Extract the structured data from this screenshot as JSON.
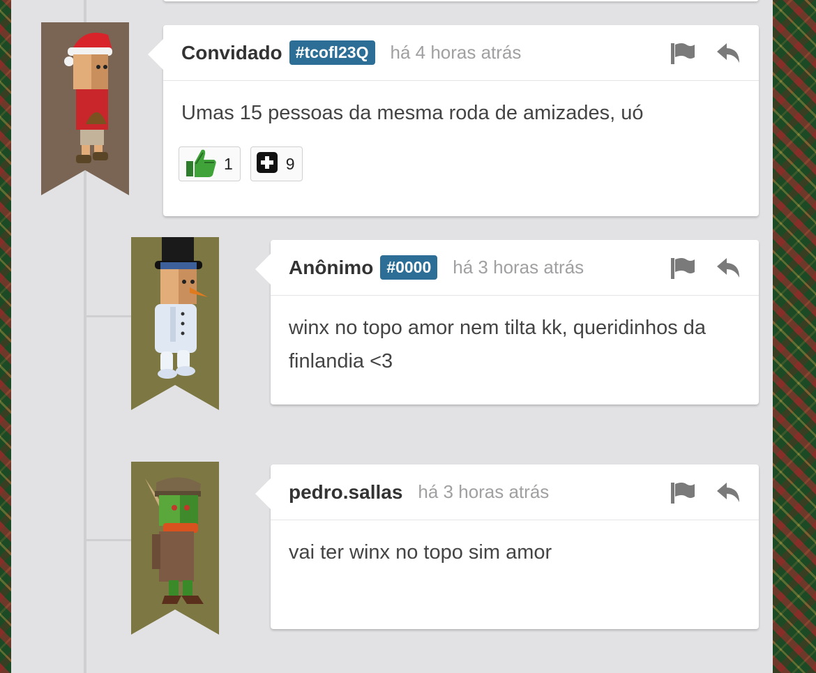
{
  "comments": [
    {
      "author": "Convidado",
      "tag": "#tcofl23Q",
      "time": "há 4 horas atrás",
      "text": "Umas 15 pessoas da mesma roda de amizades, uó",
      "reactions": [
        {
          "icon": "thumbs-up-icon",
          "count": "1"
        },
        {
          "icon": "plus-square-icon",
          "count": "9"
        }
      ],
      "ribbon_color": "#7a6554",
      "avatar": "santa-hat-avatar"
    },
    {
      "author": "Anônimo",
      "tag": "#0000",
      "time": "há 3 horas atrás",
      "text": "winx no topo amor nem tilta kk, queridinhos da finlandia <3",
      "ribbon_color": "#7d7843",
      "avatar": "snowman-top-hat-avatar"
    },
    {
      "author": "pedro.sallas",
      "time": "há 3 horas atrás",
      "text": "vai ter winx no topo sim amor",
      "ribbon_color": "#7d7843",
      "avatar": "goblin-cap-scarf-avatar"
    }
  ],
  "icons": {
    "flag": "flag-icon",
    "reply": "reply-icon"
  },
  "colors": {
    "tag_bg": "#2c6e95",
    "panel_bg": "#e2e2e4"
  }
}
